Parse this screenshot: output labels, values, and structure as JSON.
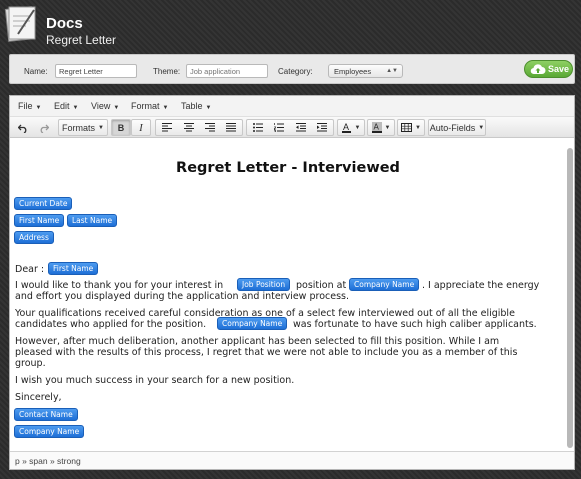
{
  "header": {
    "app_title": "Docs",
    "doc_title": "Regret Letter"
  },
  "settings": {
    "name_label": "Name:",
    "name_value": "Regret Letter",
    "theme_label": "Theme:",
    "theme_placeholder": "Job application",
    "category_label": "Category:",
    "category_selected": "Employees",
    "save_label": "Save"
  },
  "menubar": [
    "File",
    "Edit",
    "View",
    "Format",
    "Table"
  ],
  "toolbar": {
    "formats_label": "Formats",
    "autofields_label": "Auto-Fields"
  },
  "document": {
    "heading": "Regret Letter - Interviewed",
    "fields": {
      "current_date": "Current Date",
      "first_name": "First Name",
      "last_name": "Last Name",
      "address": "Address",
      "job_position": "Job Position",
      "company_name": "Company Name",
      "contact_name": "Contact Name"
    },
    "dear": "Dear :",
    "p1_a": "I would like to thank you for your interest in",
    "p1_b": "position at",
    "p1_c": ". I appreciate the energy",
    "p1_d": "and effort you displayed during the application and interview process.",
    "p2_a": "Your qualifications received careful consideration as one of a select few interviewed out of all the eligible",
    "p2_b": "candidates who applied for the position.",
    "p2_c": "was fortunate to have such high caliber applicants.",
    "p3_a": "However, after much deliberation, another applicant has been selected to fill this position. While I am",
    "p3_b": "pleased with the results of this process, I regret that we were not able to include you as a member of this",
    "p3_c": "group.",
    "p4": "I wish you much success in your search for a new position.",
    "sincerely": "Sincerely,"
  },
  "statusbar": {
    "path": "p » span » strong"
  },
  "colors": {
    "field_tag": "#2a7de1",
    "save_button": "#6dbb45"
  }
}
